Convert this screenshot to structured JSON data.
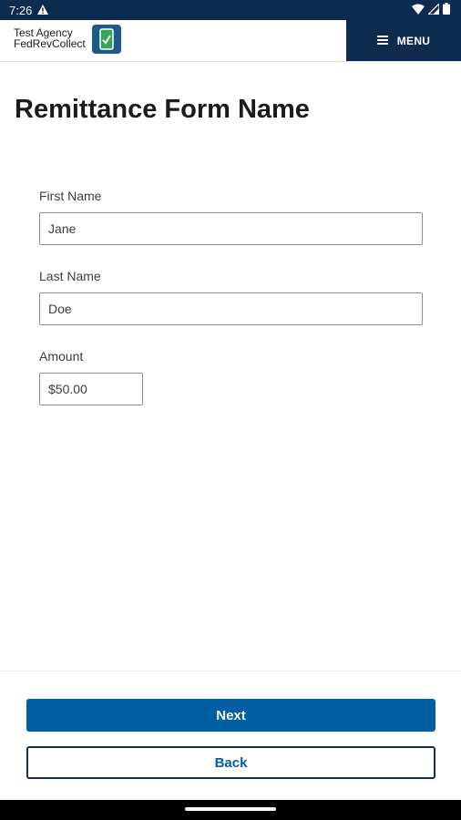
{
  "status_bar": {
    "time": "7:26"
  },
  "header": {
    "agency_line1": "Test Agency",
    "agency_line2": "FedRevCollect",
    "menu_label": "MENU"
  },
  "page": {
    "title": "Remittance Form Name"
  },
  "form": {
    "first_name_label": "First Name",
    "first_name_value": "Jane",
    "last_name_label": "Last Name",
    "last_name_value": "Doe",
    "amount_label": "Amount",
    "amount_value": "$50.00"
  },
  "actions": {
    "next_label": "Next",
    "back_label": "Back"
  },
  "colors": {
    "navy": "#0f2a4f",
    "primary": "#005ea2"
  }
}
